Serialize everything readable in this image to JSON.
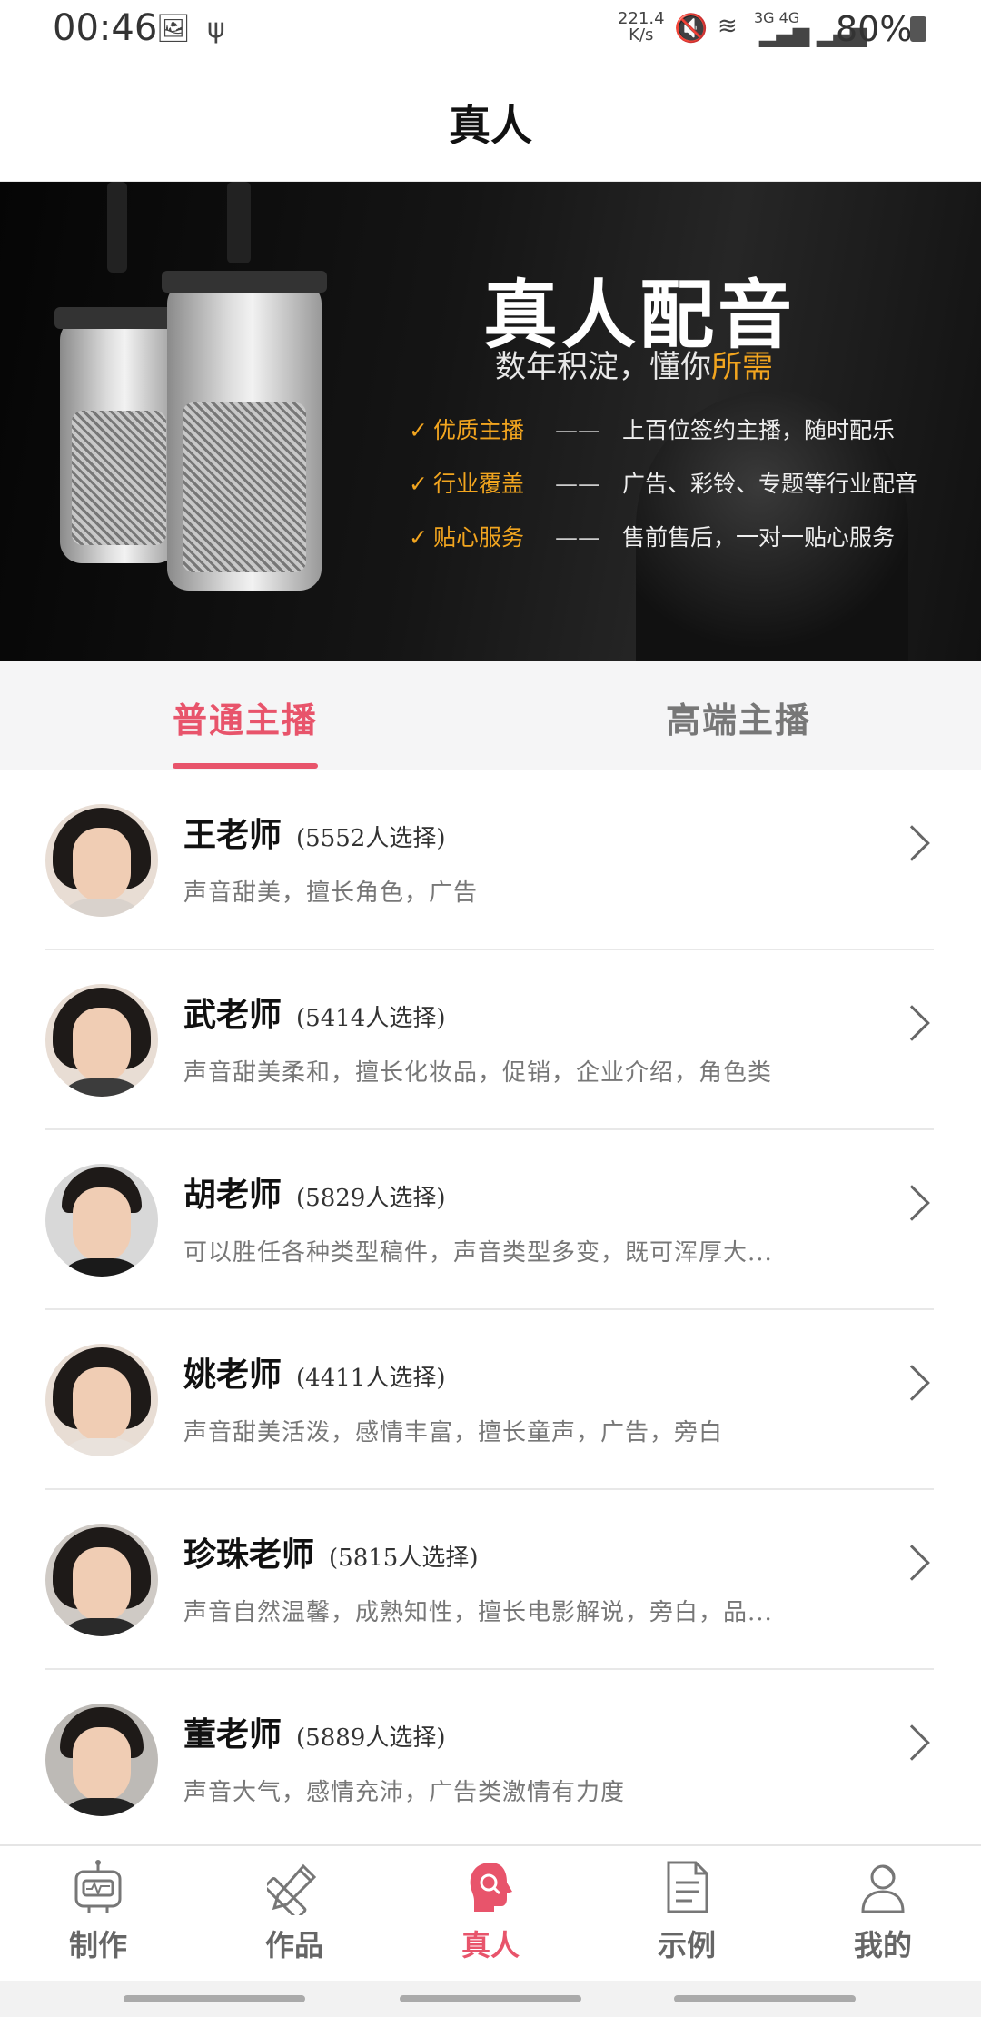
{
  "status_bar": {
    "time": "00:46",
    "speed_value": "221.4",
    "speed_unit": "K/s",
    "network": "3G 4G",
    "battery": "80%"
  },
  "header": {
    "title": "真人"
  },
  "banner": {
    "title": "真人配音",
    "subtitle_main": "数年积淀，懂你",
    "subtitle_highlight": "所需",
    "accent_color": "#f2a51f",
    "features": [
      {
        "name": "优质主播",
        "desc": "上百位签约主播，随时配乐"
      },
      {
        "name": "行业覆盖",
        "desc": "广告、彩铃、专题等行业配音"
      },
      {
        "name": "贴心服务",
        "desc": "售前售后，一对一贴心服务"
      }
    ]
  },
  "tabs": [
    {
      "label": "普通主播",
      "active": true
    },
    {
      "label": "高端主播",
      "active": false
    }
  ],
  "anchors": [
    {
      "name": "王老师",
      "count": "(5552人选择)",
      "desc": "声音甜美，擅长角色，广告"
    },
    {
      "name": "武老师",
      "count": "(5414人选择)",
      "desc": "声音甜美柔和，擅长化妆品，促销，企业介绍，角色类"
    },
    {
      "name": "胡老师",
      "count": "(5829人选择)",
      "desc": "可以胜任各种类型稿件，声音类型多变，既可浑厚大..."
    },
    {
      "name": "姚老师",
      "count": "(4411人选择)",
      "desc": "声音甜美活泼，感情丰富，擅长童声，广告，旁白"
    },
    {
      "name": "珍珠老师",
      "count": "(5815人选择)",
      "desc": "声音自然温馨，成熟知性，擅长电影解说，旁白，品..."
    },
    {
      "name": "董老师",
      "count": "(5889人选择)",
      "desc": "声音大气，感情充沛，广告类激情有力度"
    }
  ],
  "bottom_nav": [
    {
      "label": "制作",
      "icon": "robot-icon"
    },
    {
      "label": "作品",
      "icon": "pencil-ruler-icon"
    },
    {
      "label": "真人",
      "icon": "headset-person-icon",
      "active": true
    },
    {
      "label": "示例",
      "icon": "document-icon"
    },
    {
      "label": "我的",
      "icon": "user-icon"
    }
  ],
  "colors": {
    "accent": "#e8546b"
  }
}
